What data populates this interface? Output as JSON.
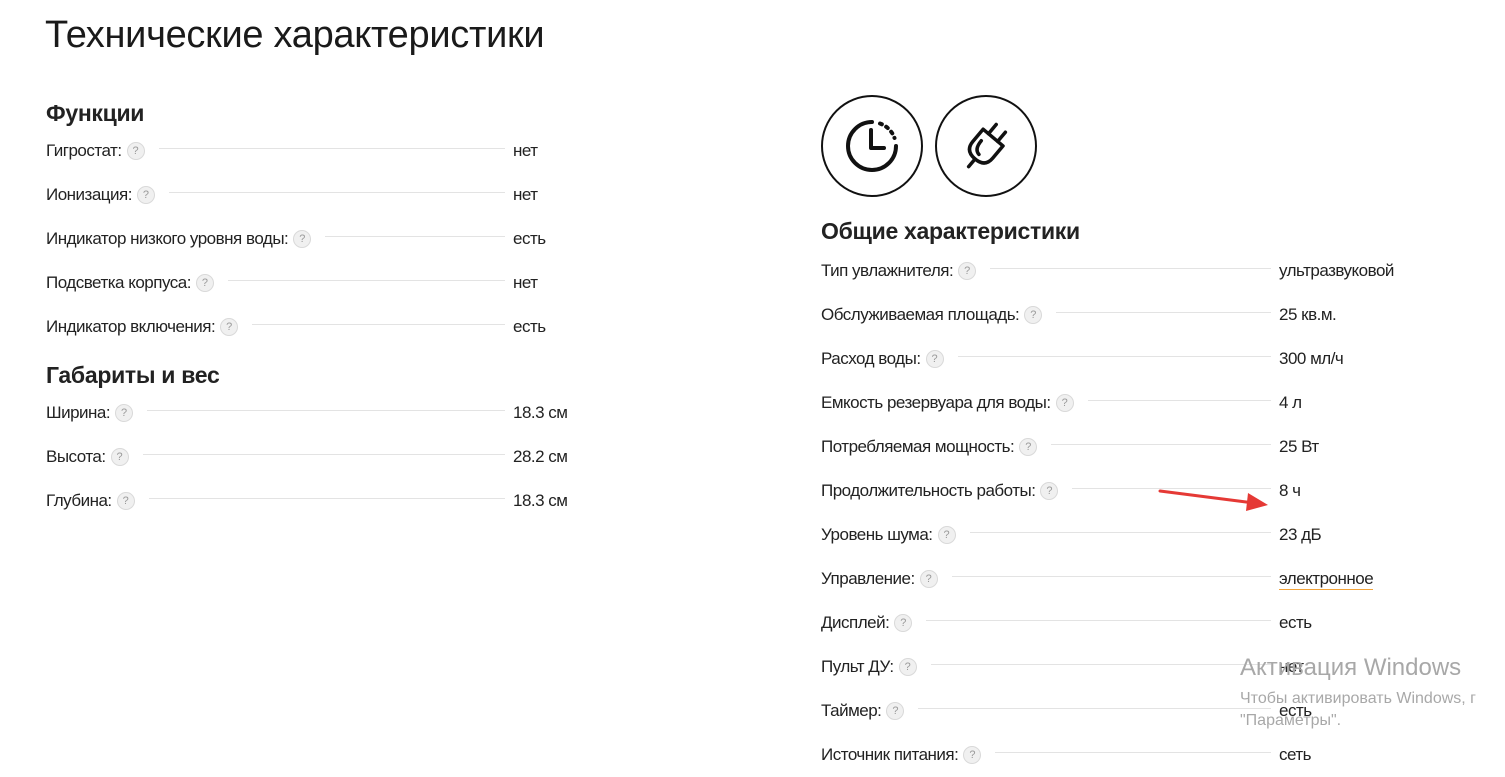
{
  "page": {
    "title": "Технические характеристики"
  },
  "left": {
    "functions": {
      "title": "Функции",
      "items": [
        {
          "label": "Гигростат:",
          "value": "нет"
        },
        {
          "label": "Ионизация:",
          "value": "нет"
        },
        {
          "label": "Индикатор низкого уровня воды:",
          "value": "есть"
        },
        {
          "label": "Подсветка корпуса:",
          "value": "нет"
        },
        {
          "label": "Индикатор включения:",
          "value": "есть"
        }
      ]
    },
    "dimensions": {
      "title": "Габариты и вес",
      "items": [
        {
          "label": "Ширина:",
          "value": "18.3 см"
        },
        {
          "label": "Высота:",
          "value": "28.2 см"
        },
        {
          "label": "Глубина:",
          "value": "18.3 см"
        }
      ]
    }
  },
  "right": {
    "icons": [
      "timer-icon",
      "power-plug-icon"
    ],
    "general": {
      "title": "Общие характеристики",
      "items": [
        {
          "label": "Тип увлажнителя:",
          "value": "ультразвуковой"
        },
        {
          "label": "Обслуживаемая площадь:",
          "value": "25 кв.м."
        },
        {
          "label": "Расход воды:",
          "value": "300 мл/ч"
        },
        {
          "label": "Емкость резервуара для воды:",
          "value": "4 л"
        },
        {
          "label": "Потребляемая мощность:",
          "value": "25 Вт"
        },
        {
          "label": "Продолжительность работы:",
          "value": "8 ч"
        },
        {
          "label": "Уровень шума:",
          "value": "23 дБ"
        },
        {
          "label": "Управление:",
          "value": "электронное"
        },
        {
          "label": "Дисплей:",
          "value": "есть"
        },
        {
          "label": "Пульт ДУ:",
          "value": "нет"
        },
        {
          "label": "Таймер:",
          "value": "есть"
        },
        {
          "label": "Источник питания:",
          "value": "сеть"
        }
      ]
    }
  },
  "help_glyph": "?",
  "annotation": {
    "arrow_color": "#e53935"
  },
  "watermark": {
    "title": "Активация Windows",
    "line1": "Чтобы активировать Windows, г",
    "line2": "\"Параметры\"."
  },
  "colors": {
    "link_underline": "#f2a33a",
    "text": "#222222",
    "dots": "#e3e3e3"
  }
}
